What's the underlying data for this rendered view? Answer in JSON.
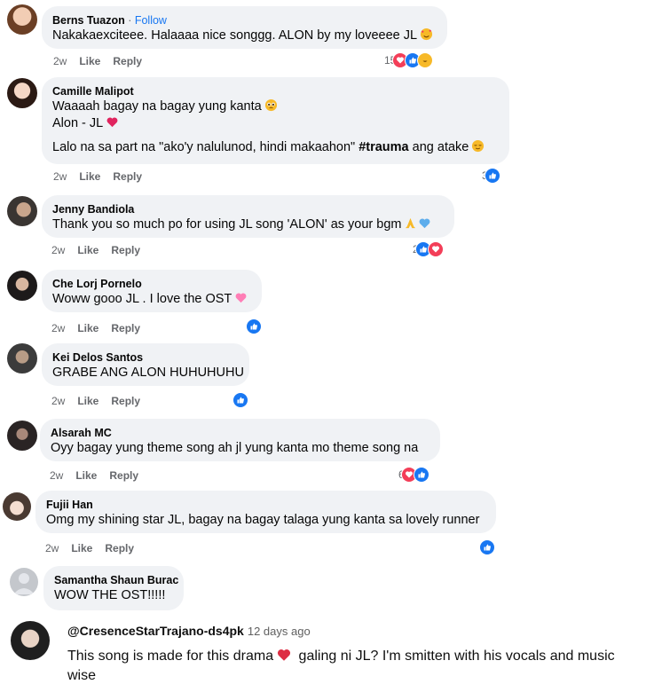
{
  "comments": [
    {
      "author": "Berns Tuazon",
      "follow": "Follow",
      "dot": " · ",
      "lines": [
        "Nakakaexciteee. Halaaaa nice songgg. ALON by my loveeee JL"
      ],
      "time": "2w",
      "like": "Like",
      "reply": "Reply",
      "count": "15",
      "reactions": [
        "love",
        "like",
        "haha"
      ]
    },
    {
      "author": "Camille Malipot",
      "lines": [
        "Waaaah bagay na bagay yung kanta",
        "Alon - JL",
        "Lalo na sa part na \"ako'y nalulunod, hindi makaahon\" ",
        "#trauma",
        " ang atake"
      ],
      "time": "2w",
      "like": "Like",
      "reply": "Reply",
      "count": "3",
      "reactions": [
        "like"
      ]
    },
    {
      "author": "Jenny Bandiola",
      "lines": [
        "Thank you so much po for using JL song 'ALON' as your bgm"
      ],
      "time": "2w",
      "like": "Like",
      "reply": "Reply",
      "count": "2",
      "reactions": [
        "like",
        "love"
      ]
    },
    {
      "author": "Che Lorj Pornelo",
      "lines": [
        "Woww gooo JL . I love the OST"
      ],
      "time": "2w",
      "like": "Like",
      "reply": "Reply",
      "count": "",
      "reactions": [
        "like"
      ]
    },
    {
      "author": "Kei Delos Santos",
      "lines": [
        "GRABE ANG ALON HUHUHUHU"
      ],
      "time": "2w",
      "like": "Like",
      "reply": "Reply",
      "count": "",
      "reactions": [
        "like"
      ]
    },
    {
      "author": "Alsarah MC",
      "lines": [
        "Oyy bagay yung theme song ah jl yung kanta mo theme song na"
      ],
      "time": "2w",
      "like": "Like",
      "reply": "Reply",
      "count": "6",
      "reactions": [
        "love",
        "like"
      ]
    },
    {
      "author": "Fujii Han",
      "lines": [
        "Omg my shining star JL, bagay na bagay talaga yung kanta sa lovely runner"
      ],
      "time": "2w",
      "like": "Like",
      "reply": "Reply",
      "count": "",
      "reactions": [
        "like"
      ]
    },
    {
      "author": "Samantha Shaun Burac",
      "lines": [
        "WOW THE OST!!!!!"
      ]
    }
  ],
  "youtube": {
    "handle": "@CresenceStarTrajano-ds4pk",
    "time": "12 days ago",
    "text1": "This song is made for this drama",
    "text2": " galing ni JL? I'm smitten with his vocals and music",
    "text3": "wise"
  },
  "colors": {
    "bubble": "#f0f2f5",
    "like": "#1877f2",
    "love": "#f33e58",
    "haha": "#f7b928"
  }
}
